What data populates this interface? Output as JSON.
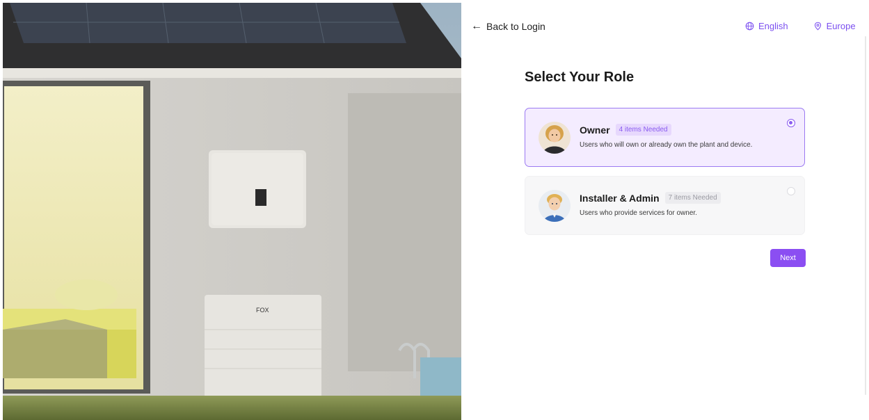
{
  "nav": {
    "back_label": "Back to Login",
    "language_label": "English",
    "region_label": "Europe"
  },
  "page": {
    "title": "Select Your Role"
  },
  "hero": {
    "brand_mark": "FOX"
  },
  "roles": [
    {
      "name": "Owner",
      "badge": "4 items Needed",
      "description": "Users who will own or already own the plant and device.",
      "selected": true
    },
    {
      "name": "Installer & Admin",
      "badge": "7 items Needed",
      "description": "Users who provide services for owner.",
      "selected": false
    }
  ],
  "actions": {
    "next_label": "Next"
  },
  "colors": {
    "accent": "#8b4ef2",
    "selected_card_bg": "#f4ecff",
    "selected_card_border": "#9b7af2"
  }
}
